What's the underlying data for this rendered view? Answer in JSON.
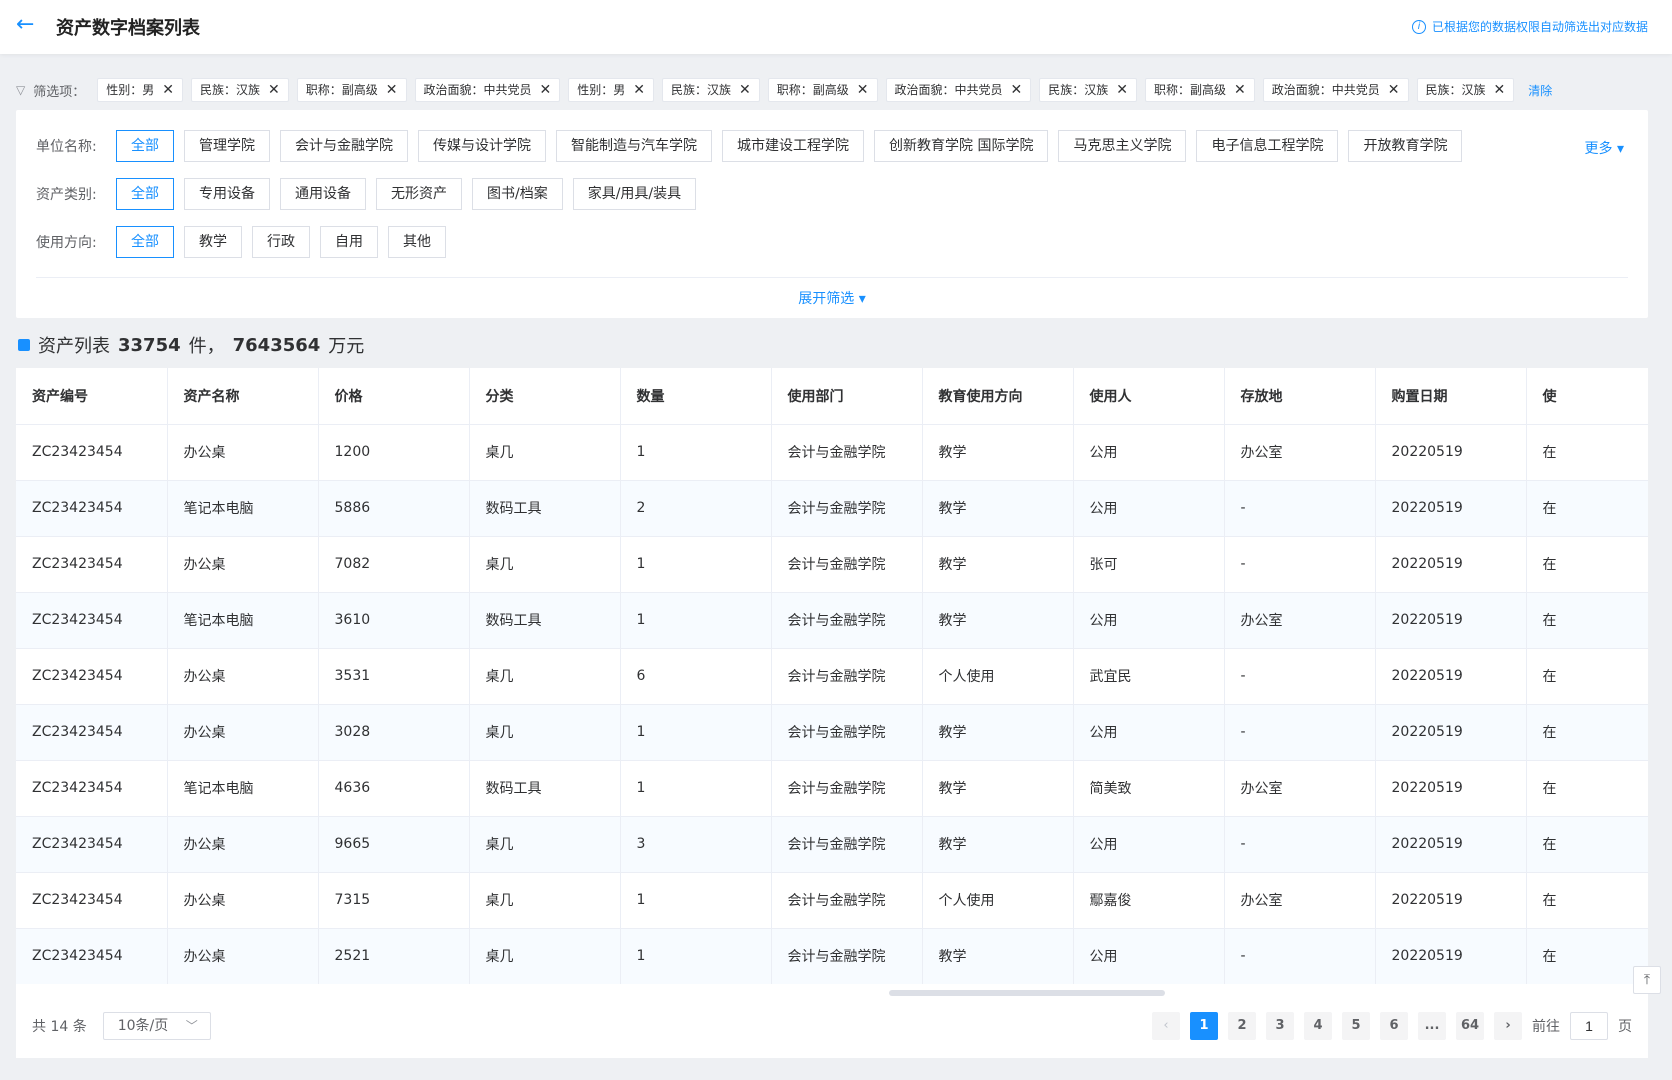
{
  "header": {
    "title": "资产数字档案列表",
    "permission_note": "已根据您的数据权限自动筛选出对应数据"
  },
  "chips": {
    "label": "筛选项：",
    "items": [
      "性别：男",
      "民族：汉族",
      "职称：副高级",
      "政治面貌：中共党员",
      "性别：男",
      "民族：汉族",
      "职称：副高级",
      "政治面貌：中共党员",
      "民族：汉族",
      "职称：副高级",
      "政治面貌：中共党员",
      "民族：汉族"
    ],
    "clear_label": "清除"
  },
  "filters": {
    "unit": {
      "label": "单位名称:",
      "options": [
        "全部",
        "管理学院",
        "会计与金融学院",
        "传媒与设计学院",
        "智能制造与汽车学院",
        "城市建设工程学院",
        "创新教育学院 国际学院",
        "马克思主义学院",
        "电子信息工程学院",
        "开放教育学院"
      ]
    },
    "category": {
      "label": "资产类别:",
      "options": [
        "全部",
        "专用设备",
        "通用设备",
        "无形资产",
        "图书/档案",
        "家具/用具/装具"
      ]
    },
    "usage": {
      "label": "使用方向:",
      "options": [
        "全部",
        "教学",
        "行政",
        "自用",
        "其他"
      ]
    },
    "more_label": "更多",
    "expand_label": "展开筛选"
  },
  "list": {
    "title_prefix": "资产列表",
    "count": "33754",
    "unit1": "件，",
    "amount": "7643564",
    "unit2": "万元"
  },
  "table": {
    "columns": [
      "资产编号",
      "资产名称",
      "价格",
      "分类",
      "数量",
      "使用部门",
      "教育使用方向",
      "使用人",
      "存放地",
      "购置日期",
      "使"
    ],
    "rows": [
      [
        "ZC23423454",
        "办公桌",
        "1200",
        "桌几",
        "1",
        "会计与金融学院",
        "教学",
        "公用",
        "办公室",
        "20220519",
        "在"
      ],
      [
        "ZC23423454",
        "笔记本电脑",
        "5886",
        "数码工具",
        "2",
        "会计与金融学院",
        "教学",
        "公用",
        "-",
        "20220519",
        "在"
      ],
      [
        "ZC23423454",
        "办公桌",
        "7082",
        "桌几",
        "1",
        "会计与金融学院",
        "教学",
        "张可",
        "-",
        "20220519",
        "在"
      ],
      [
        "ZC23423454",
        "笔记本电脑",
        "3610",
        "数码工具",
        "1",
        "会计与金融学院",
        "教学",
        "公用",
        "办公室",
        "20220519",
        "在"
      ],
      [
        "ZC23423454",
        "办公桌",
        "3531",
        "桌几",
        "6",
        "会计与金融学院",
        "个人使用",
        "武宜民",
        "-",
        "20220519",
        "在"
      ],
      [
        "ZC23423454",
        "办公桌",
        "3028",
        "桌几",
        "1",
        "会计与金融学院",
        "教学",
        "公用",
        "-",
        "20220519",
        "在"
      ],
      [
        "ZC23423454",
        "笔记本电脑",
        "4636",
        "数码工具",
        "1",
        "会计与金融学院",
        "教学",
        "简美致",
        "办公室",
        "20220519",
        "在"
      ],
      [
        "ZC23423454",
        "办公桌",
        "9665",
        "桌几",
        "3",
        "会计与金融学院",
        "教学",
        "公用",
        "-",
        "20220519",
        "在"
      ],
      [
        "ZC23423454",
        "办公桌",
        "7315",
        "桌几",
        "1",
        "会计与金融学院",
        "个人使用",
        "鄢嘉俊",
        "办公室",
        "20220519",
        "在"
      ],
      [
        "ZC23423454",
        "办公桌",
        "2521",
        "桌几",
        "1",
        "会计与金融学院",
        "教学",
        "公用",
        "-",
        "20220519",
        "在"
      ]
    ]
  },
  "pagination": {
    "total": "共 14 条",
    "page_size": "10条/页",
    "pages": [
      "1",
      "2",
      "3",
      "4",
      "5",
      "6",
      "...",
      "64"
    ],
    "current": "1",
    "goto_label": "前往",
    "goto_value": "1",
    "page_unit": "页"
  }
}
